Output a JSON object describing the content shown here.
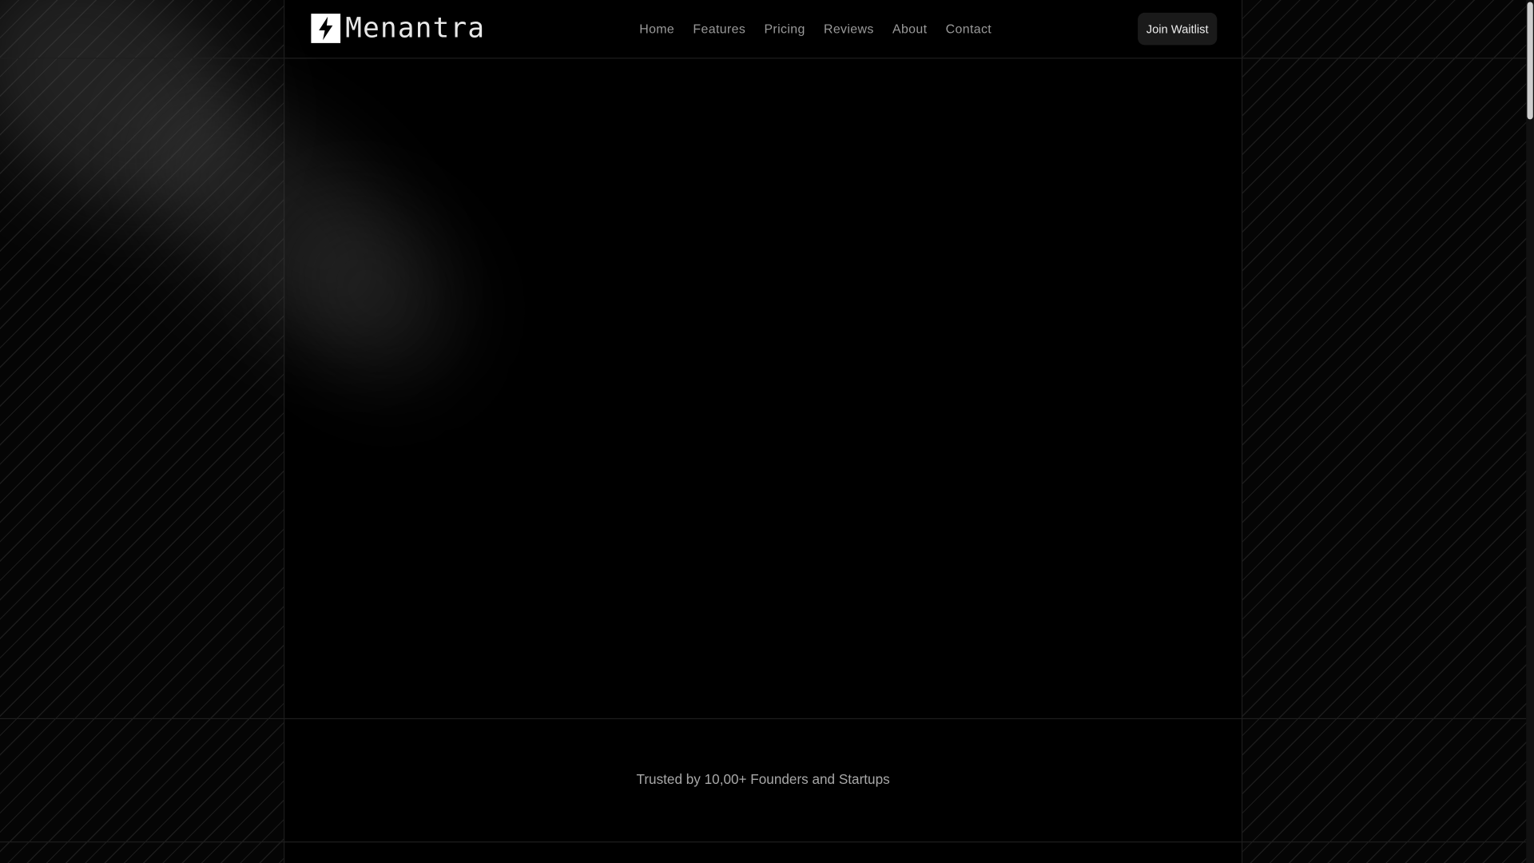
{
  "brand": {
    "name": "Menantra",
    "icon": "lightning-bolt-icon"
  },
  "nav": {
    "items": [
      {
        "label": "Home"
      },
      {
        "label": "Features"
      },
      {
        "label": "Pricing"
      },
      {
        "label": "Reviews"
      },
      {
        "label": "About"
      },
      {
        "label": "Contact"
      }
    ]
  },
  "header": {
    "cta_label": "Join Waitlist"
  },
  "trusted": {
    "text": "Trusted by 10,00+ Founders and Startups"
  },
  "colors": {
    "background": "#000000",
    "button": "#1a1a1a",
    "nav_text": "#9a9a9a"
  }
}
